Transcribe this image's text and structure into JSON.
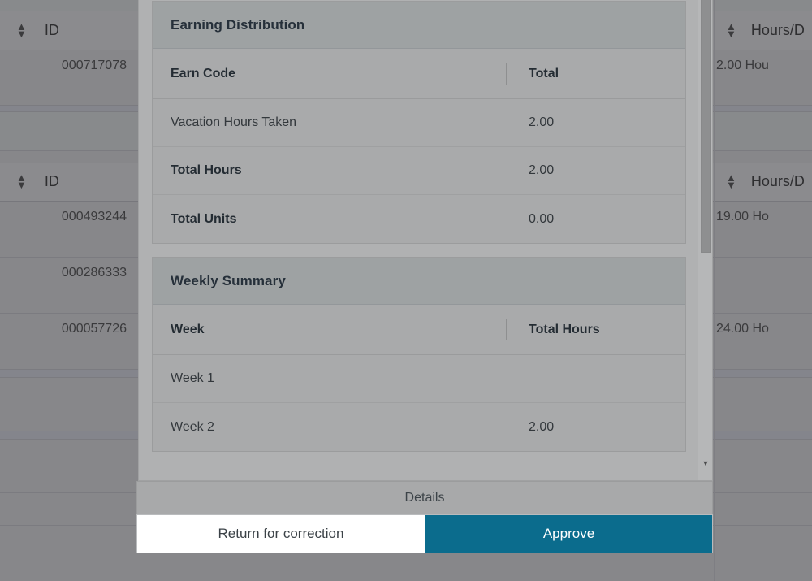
{
  "background": {
    "sort_icon": "sort-updown-icon",
    "tables": [
      {
        "header": {
          "id_label": "ID",
          "hours_label": "Hours/D"
        },
        "rows": [
          {
            "id": "000717078",
            "hours": "2.00 Hou"
          }
        ]
      },
      {
        "header": {
          "id_label": "ID",
          "hours_label": "Hours/D"
        },
        "rows": [
          {
            "id": "000493244",
            "hours": "19.00 Ho"
          },
          {
            "id": "000286333",
            "hours": ""
          },
          {
            "id": "000057726",
            "hours": "24.00 Ho"
          }
        ]
      }
    ]
  },
  "modal": {
    "cards": [
      {
        "title": "Earning Distribution",
        "columns": [
          "Earn Code",
          "Total"
        ],
        "rows": [
          {
            "label": "Vacation Hours Taken",
            "value": "2.00",
            "strong": false
          },
          {
            "label": "Total Hours",
            "value": "2.00",
            "strong": true
          },
          {
            "label": "Total Units",
            "value": "0.00",
            "strong": true
          }
        ]
      },
      {
        "title": "Weekly Summary",
        "columns": [
          "Week",
          "Total Hours"
        ],
        "rows": [
          {
            "label": "Week 1",
            "value": "",
            "strong": false
          },
          {
            "label": "Week 2",
            "value": "2.00",
            "strong": false
          }
        ]
      }
    ],
    "scrollbar": {
      "down_arrow_glyph": "▼"
    }
  },
  "footer": {
    "details_label": "Details",
    "return_label": "Return for correction",
    "approve_label": "Approve"
  },
  "colors": {
    "approve_button": "#0b6c8d",
    "modal_background": "#b0b1b2",
    "card_header": "#9ea2a3",
    "page_backdrop": "#87878a"
  }
}
